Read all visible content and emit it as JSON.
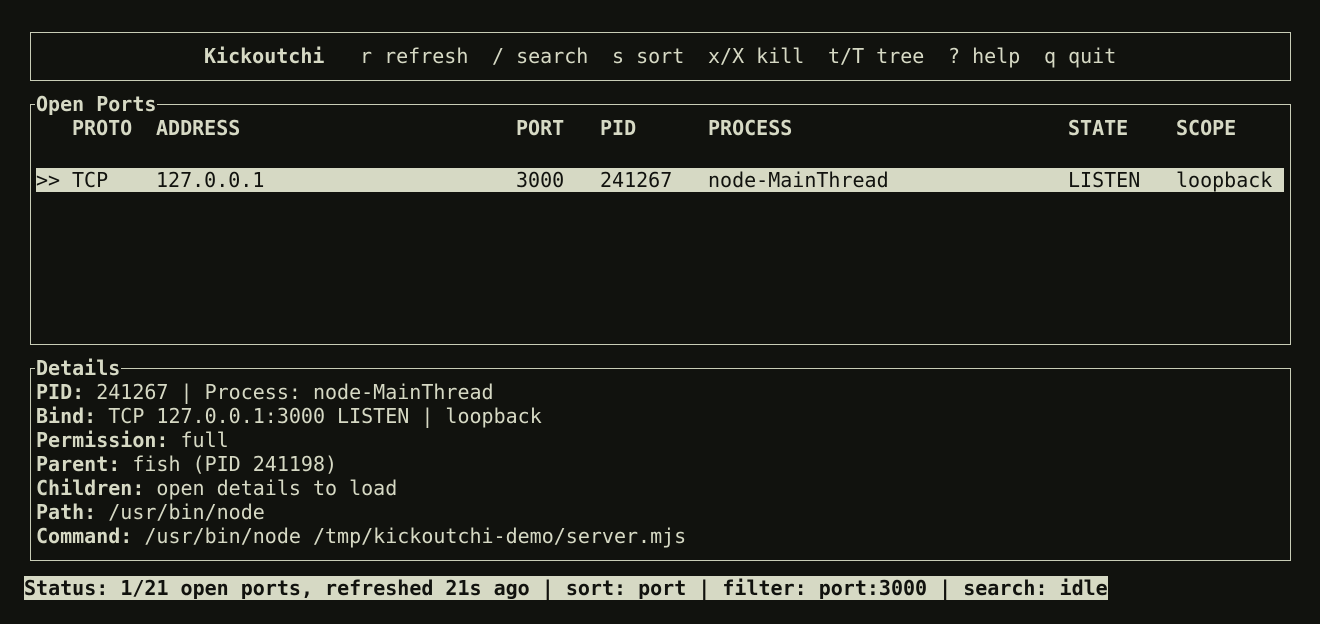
{
  "header": {
    "app_name": "Kickoutchi",
    "shortcuts": [
      {
        "key": "r",
        "label": "refresh"
      },
      {
        "key": "/",
        "label": "search"
      },
      {
        "key": "s",
        "label": "sort"
      },
      {
        "key": "x/X",
        "label": "kill"
      },
      {
        "key": "t/T",
        "label": "tree"
      },
      {
        "key": "?",
        "label": "help"
      },
      {
        "key": "q",
        "label": "quit"
      }
    ]
  },
  "ports_panel": {
    "title": "Open Ports",
    "columns": {
      "proto": "PROTO",
      "address": "ADDRESS",
      "port": "PORT",
      "pid": "PID",
      "process": "PROCESS",
      "state": "STATE",
      "scope": "SCOPE"
    },
    "rows": [
      {
        "marker": ">>",
        "proto": "TCP",
        "address": "127.0.0.1",
        "port": "3000",
        "pid": "241267",
        "process": "node-MainThread",
        "state": "LISTEN",
        "scope": "loopback"
      }
    ]
  },
  "details_panel": {
    "title": "Details",
    "lines": [
      {
        "label": "PID:",
        "value": " 241267 | Process: node-MainThread"
      },
      {
        "label": "Bind:",
        "value": " TCP 127.0.0.1:3000 LISTEN | loopback"
      },
      {
        "label": "Permission:",
        "value": " full"
      },
      {
        "label": "Parent:",
        "value": " fish (PID 241198)"
      },
      {
        "label": "Children:",
        "value": " open details to load"
      },
      {
        "label": "Path:",
        "value": " /usr/bin/node"
      },
      {
        "label": "Command:",
        "value": " /usr/bin/node /tmp/kickoutchi-demo/server.mjs"
      }
    ]
  },
  "status": {
    "text": "Status: 1/21 open ports, refreshed 21s ago | sort: port | filter: port:3000 | search: idle"
  }
}
